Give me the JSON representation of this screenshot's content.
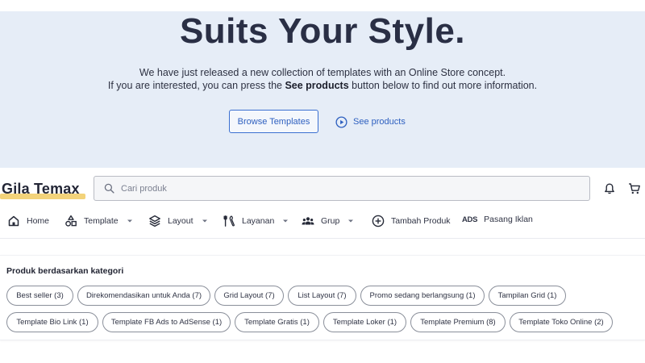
{
  "hero": {
    "title": "Suits Your Style.",
    "line1": "We have just released a new collection of templates with an Online Store concept.",
    "line2_pre": "If you are interested, you can press the ",
    "line2_bold": "See products",
    "line2_post": " button below to find out more information.",
    "browse_label": "Browse Templates",
    "see_label": "See products"
  },
  "header": {
    "logo": "Gila Temax",
    "search_placeholder": "Cari produk"
  },
  "nav": {
    "home": "Home",
    "template": "Template",
    "layout": "Layout",
    "layanan": "Layanan",
    "grup": "Grup",
    "tambah": "Tambah Produk",
    "ads_badge": "ADS",
    "pasang": "Pasang Iklan"
  },
  "categories": {
    "title": "Produk berdasarkan kategori",
    "chips": [
      "Best seller  (3)",
      "Direkomendasikan untuk Anda  (7)",
      "Grid Layout  (7)",
      "List Layout  (7)",
      "Promo sedang berlangsung  (1)",
      "Tampilan Grid  (1)",
      "Template Bio Link  (1)",
      "Template FB Ads to AdSense  (1)",
      "Template Gratis  (1)",
      "Template Loker  (1)",
      "Template Premium  (8)",
      "Template Toko Online  (2)"
    ]
  },
  "colors": {
    "hero_bg": "#e6edf7",
    "accent": "#2d5fbf",
    "logo_highlight": "#f3d37a"
  }
}
